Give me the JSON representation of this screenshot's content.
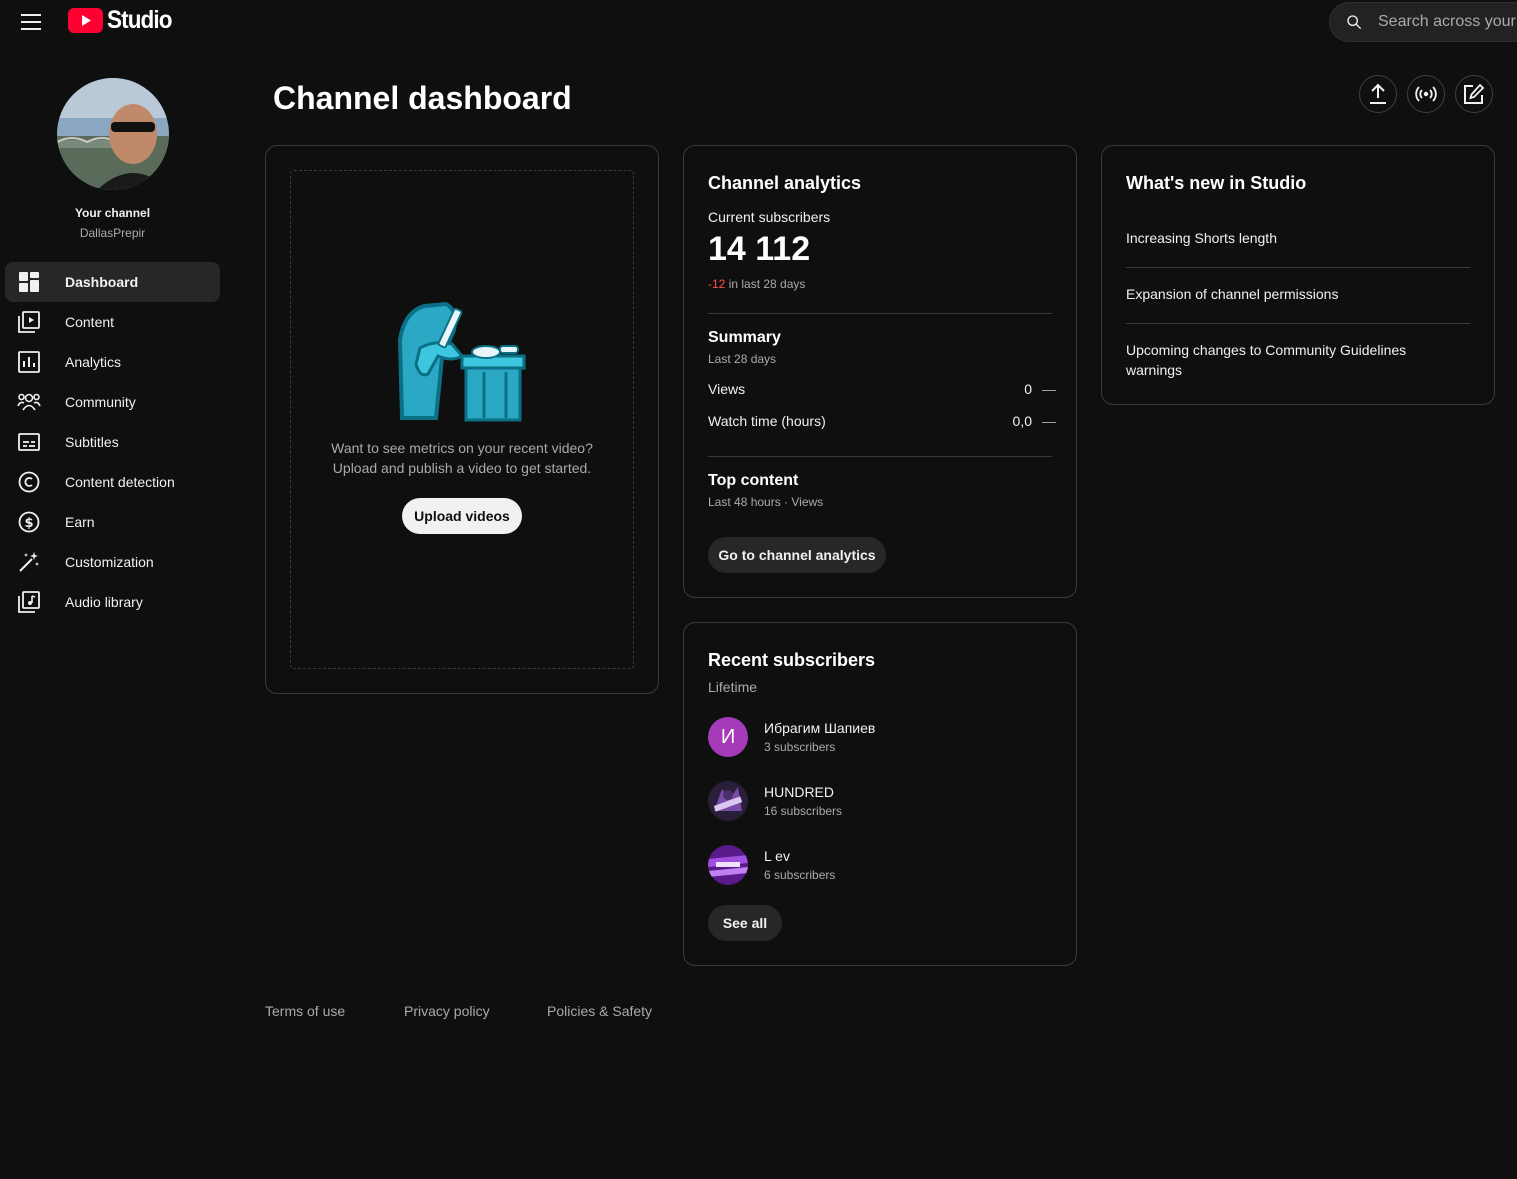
{
  "header": {
    "logo_text": "Studio",
    "search_placeholder": "Search across your channel"
  },
  "sidebar": {
    "your_channel_label": "Your channel",
    "channel_handle": "DallasPrepir",
    "items": [
      {
        "label": "Dashboard",
        "icon": "dashboard-icon",
        "active": true
      },
      {
        "label": "Content",
        "icon": "content-icon"
      },
      {
        "label": "Analytics",
        "icon": "analytics-icon"
      },
      {
        "label": "Community",
        "icon": "community-icon"
      },
      {
        "label": "Subtitles",
        "icon": "subtitles-icon"
      },
      {
        "label": "Content detection",
        "icon": "copyright-icon"
      },
      {
        "label": "Earn",
        "icon": "dollar-icon"
      },
      {
        "label": "Customization",
        "icon": "magic-wand-icon"
      },
      {
        "label": "Audio library",
        "icon": "audio-library-icon"
      }
    ]
  },
  "page": {
    "title": "Channel dashboard"
  },
  "upload_card": {
    "line1": "Want to see metrics on your recent video?",
    "line2": "Upload and publish a video to get started.",
    "button": "Upload videos"
  },
  "analytics_card": {
    "title": "Channel analytics",
    "current_subscribers_label": "Current subscribers",
    "subscribers": "14 112",
    "change": "-12",
    "change_suffix": "in last 28 days",
    "summary_title": "Summary",
    "summary_period": "Last 28 days",
    "views_label": "Views",
    "views_value": "0",
    "watch_label": "Watch time (hours)",
    "watch_value": "0,0",
    "trend_dash": "—",
    "top_content_title": "Top content",
    "top_content_period": "Last 48 hours · Views",
    "button": "Go to channel analytics"
  },
  "subscribers_card": {
    "title": "Recent subscribers",
    "period": "Lifetime",
    "items": [
      {
        "name": "Ибрагим Шапиев",
        "count": "3 subscribers",
        "initial": "И"
      },
      {
        "name": "HUNDRED",
        "count": "16 subscribers"
      },
      {
        "name": "L ev",
        "count": "6 subscribers"
      }
    ],
    "button": "See all"
  },
  "news_card": {
    "title": "What's new in Studio",
    "items": [
      "Increasing Shorts length",
      "Expansion of channel permissions",
      "Upcoming changes to Community Guidelines warnings"
    ]
  },
  "footer": {
    "links": [
      "Terms of use",
      "Privacy policy",
      "Policies & Safety"
    ]
  },
  "colors": {
    "background": "#0f0f0f",
    "accent_red": "#ff0033",
    "negative": "#ff4e45",
    "illustration_cyan": "#3ec6e0",
    "avatar_purple": "#a53bb8"
  }
}
